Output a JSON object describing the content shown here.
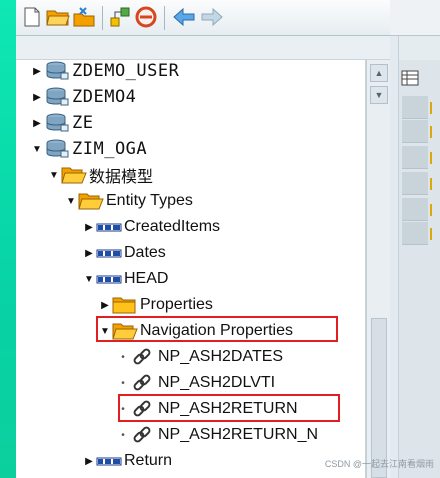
{
  "toolbar": {
    "buttons": [
      {
        "icon": "new-document-icon"
      },
      {
        "icon": "open-folder-icon"
      },
      {
        "icon": "tools-icon"
      },
      {
        "icon": "hierarchy-icon"
      },
      {
        "icon": "cancel-icon"
      },
      {
        "icon": "back-arrow-icon"
      },
      {
        "icon": "forward-arrow-icon"
      }
    ]
  },
  "tree": {
    "nodes": [
      {
        "label": "ZDEMO_USER",
        "type": "project",
        "expanded": false
      },
      {
        "label": "ZDEMO4",
        "type": "project",
        "expanded": false
      },
      {
        "label": "ZE",
        "type": "project",
        "expanded": false
      },
      {
        "label": "ZIM_OGA",
        "type": "project",
        "expanded": true
      },
      {
        "label": "数据模型",
        "type": "folder",
        "expanded": true
      },
      {
        "label": "Entity Types",
        "type": "folder",
        "expanded": true
      },
      {
        "label": "CreatedItems",
        "type": "entity",
        "expanded": false
      },
      {
        "label": "Dates",
        "type": "entity",
        "expanded": false
      },
      {
        "label": "HEAD",
        "type": "entity",
        "expanded": true
      },
      {
        "label": "Properties",
        "type": "folder",
        "expanded": false
      },
      {
        "label": "Navigation Properties",
        "type": "folder",
        "expanded": true,
        "highlighted": true
      },
      {
        "label": "NP_ASH2DATES",
        "type": "nav-property"
      },
      {
        "label": "NP_ASH2DLVTI",
        "type": "nav-property"
      },
      {
        "label": "NP_ASH2RETURN",
        "type": "nav-property",
        "highlighted": true
      },
      {
        "label": "NP_ASH2RETURN_N",
        "type": "nav-property"
      },
      {
        "label": "Return",
        "type": "entity",
        "expanded": false
      }
    ]
  },
  "right_pane": {
    "header_icon": "table-settings-icon"
  },
  "watermark": "CSDN @一起去江南看烟雨",
  "colors": {
    "highlight": "#e02020",
    "folder": "#f4a000",
    "accent_green": "#07d3a6"
  }
}
